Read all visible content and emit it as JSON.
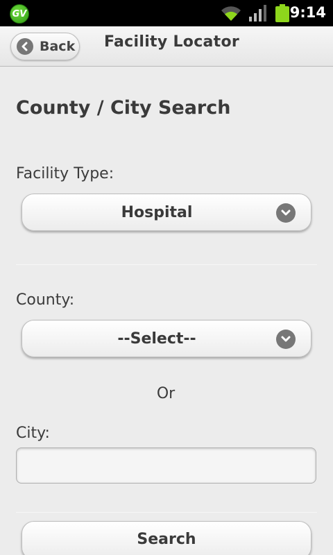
{
  "status_bar": {
    "app_badge": "GV",
    "time": "9:14",
    "icons": [
      "wifi-icon",
      "signal-icon",
      "battery-icon"
    ]
  },
  "header": {
    "back_label": "Back",
    "title": "Facility Locator"
  },
  "form": {
    "heading": "County / City Search",
    "facility_type_label": "Facility Type:",
    "facility_type_value": "Hospital",
    "county_label": "County:",
    "county_value": "--Select--",
    "or_label": "Or",
    "city_label": "City:",
    "city_value": "",
    "search_label": "Search"
  },
  "colors": {
    "background": "#ececec",
    "status_bar": "#000000",
    "badge_green": "#3fb01c",
    "battery_green": "#8ed61c",
    "icon_gray": "#777777"
  }
}
